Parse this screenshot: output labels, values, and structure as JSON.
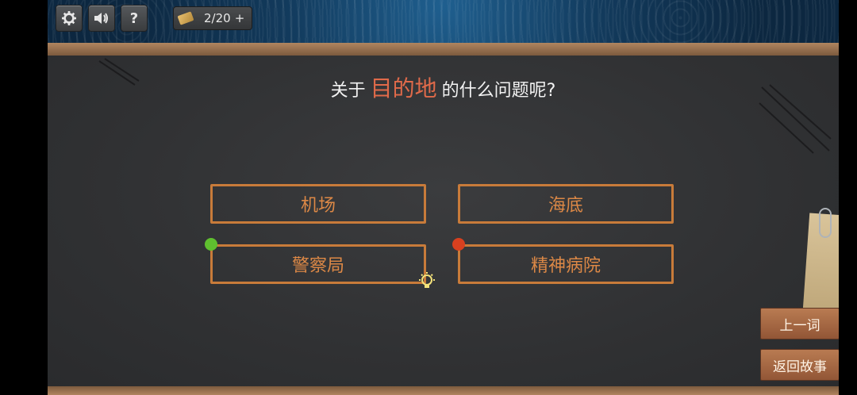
{
  "toolbar": {
    "settings_icon": "gear-icon",
    "sound_icon": "speaker-icon",
    "help_label": "?",
    "hint_counter": "2/20",
    "add_label": "+"
  },
  "question": {
    "prefix": "关于",
    "keyword": "目的地",
    "suffix": "的什么问题呢?"
  },
  "options": [
    {
      "label": "机场"
    },
    {
      "label": "海底"
    },
    {
      "label": "警察局",
      "marker_color": "#5fbf2f"
    },
    {
      "label": "精神病院",
      "marker_color": "#d8401f"
    }
  ],
  "side_buttons": {
    "prev_word": "上一词",
    "back_to_story": "返回故事"
  },
  "colors": {
    "keyword": "#e06a4a",
    "option_border": "#c87b3a",
    "button_bg": "#a8683f"
  }
}
